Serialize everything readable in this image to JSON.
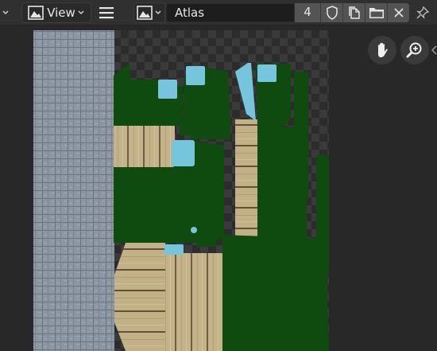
{
  "header": {
    "editor_type_icon": "image-editor-icon",
    "view_menu_icon": "image-icon",
    "view_label": "View",
    "menu_icon": "hamburger-icon",
    "browse_image_icon": "image-icon",
    "image_name": "Atlas",
    "users_count": "4",
    "fake_user_icon": "shield-icon",
    "new_image_icon": "duplicate-icon",
    "open_image_icon": "folder-icon",
    "unlink_icon": "close-icon",
    "pin_icon": "pin-icon"
  },
  "canvas": {
    "texture_name": "Atlas",
    "navigation": [
      {
        "name": "pan",
        "icon": "hand-icon"
      },
      {
        "name": "zoom",
        "icon": "zoom-in-icon"
      }
    ]
  },
  "colors": {
    "header_bg": "#303030",
    "field_bg": "#545454",
    "uv_island_green": "#0f4a0f",
    "uv_highlight_cyan": "#75c6dc",
    "wood_tan": "#c4b38a",
    "stone_gray": "#8d96a3"
  }
}
